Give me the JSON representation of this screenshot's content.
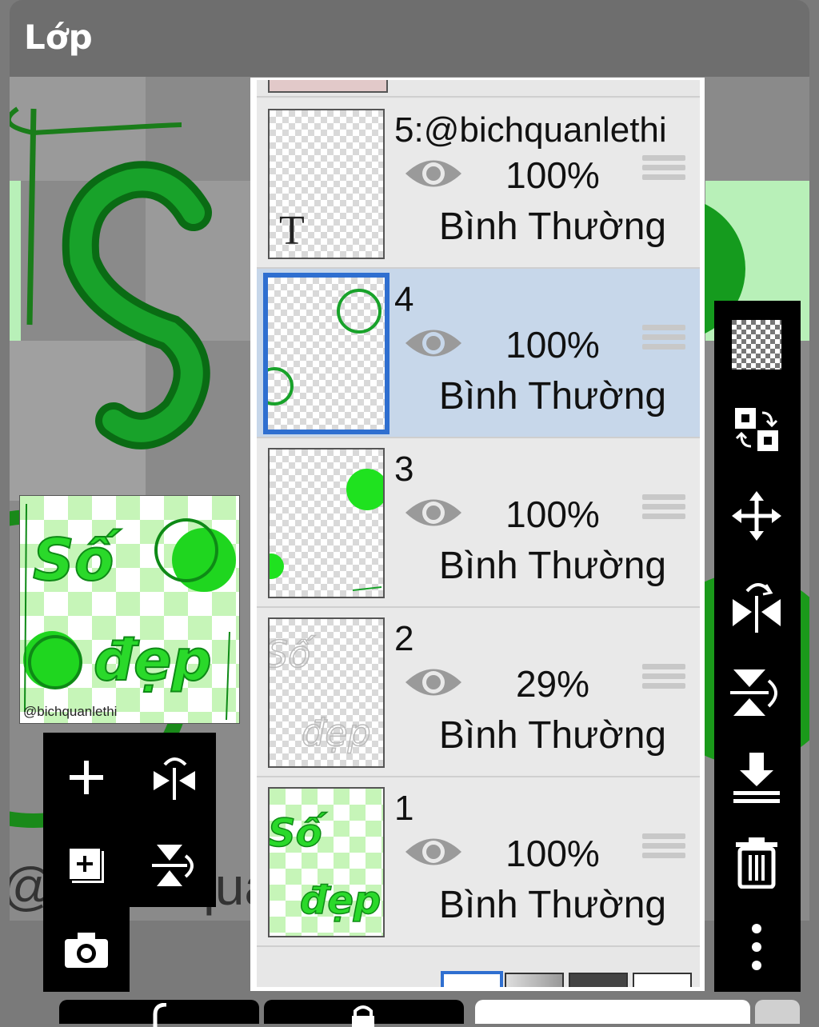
{
  "header": {
    "title": "Lớp"
  },
  "thumbnail": {
    "text_line1": "Số",
    "text_line2": "đẹp",
    "credit": "@bichquanlethi"
  },
  "canvas": {
    "credit_fragment_left": "@",
    "credit_fragment_right": "quan"
  },
  "layers": [
    {
      "name": "5:@bichquanlethi",
      "opacity": "100%",
      "blend": "Bình Thường",
      "visible": true,
      "selected": false,
      "thumb_letter": "T"
    },
    {
      "name": "4",
      "opacity": "100%",
      "blend": "Bình Thường",
      "visible": true,
      "selected": true
    },
    {
      "name": "3",
      "opacity": "100%",
      "blend": "Bình Thường",
      "visible": true,
      "selected": false
    },
    {
      "name": "2",
      "opacity": "29%",
      "blend": "Bình Thường",
      "visible": true,
      "selected": false,
      "thumb_text1": "Số",
      "thumb_text2": "đẹp"
    },
    {
      "name": "1",
      "opacity": "100%",
      "blend": "Bình Thường",
      "visible": true,
      "selected": false,
      "thumb_text1": "Số",
      "thumb_text2": "đẹp"
    }
  ],
  "right_tools": [
    "transparency-icon",
    "swap-icon",
    "move-icon",
    "flip-horizontal-icon",
    "flip-vertical-icon",
    "merge-down-icon",
    "trash-icon",
    "more-icon"
  ],
  "left_tools": [
    "add-layer-icon",
    "flip-horizontal-icon",
    "add-copy-layer-icon",
    "flip-vertical-icon",
    "camera-icon"
  ],
  "colors": {
    "accent": "#2f6fd0",
    "selected_row": "#c7d7ea",
    "green": "#1fd61f",
    "dark_green": "#0b8a17"
  }
}
